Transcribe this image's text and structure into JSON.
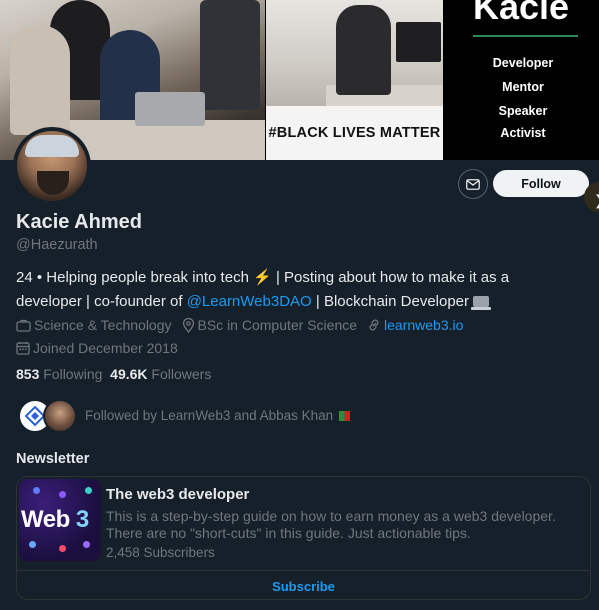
{
  "banner": {
    "name": "Kacie",
    "roles": [
      "Developer",
      "Mentor",
      "Speaker",
      "Activist"
    ],
    "sign_text": "#BLACK LIVES MATTER"
  },
  "actions": {
    "message_icon": "envelope-icon",
    "follow_label": "Follow"
  },
  "profile": {
    "display_name": "Kacie Ahmed",
    "handle": "@Haezurath",
    "bio_part1": "24 • Helping people break into tech",
    "bio_emoji": "⚡",
    "bio_part2": "| Posting about how to make it as a developer | co-founder of",
    "bio_link": "@LearnWeb3DAO",
    "bio_part3": "| Blockchain Developer",
    "category": "Science & Technology",
    "location": "BSc in Computer Science",
    "website": "learnweb3.io",
    "joined": "Joined December 2018"
  },
  "stats": {
    "following_count": "853",
    "following_label": "Following",
    "followers_count": "49.6K",
    "followers_label": "Followers"
  },
  "followed_by": {
    "text": "Followed by LearnWeb3 and Abbas Khan"
  },
  "newsletter": {
    "heading": "Newsletter",
    "thumb_text_main": "Web",
    "thumb_text_num": "3",
    "title": "The web3 developer",
    "description": "This is a step-by-step guide on how to earn money as a web3 developer. There are no \"short-cuts\" in this guide. Just actionable tips.",
    "subscribers": "2,458 Subscribers",
    "subscribe_label": "Subscribe"
  },
  "colors": {
    "background": "#15202b",
    "accent": "#1d9bf0",
    "muted": "#71767b",
    "follow_bg": "#eff3f4"
  }
}
